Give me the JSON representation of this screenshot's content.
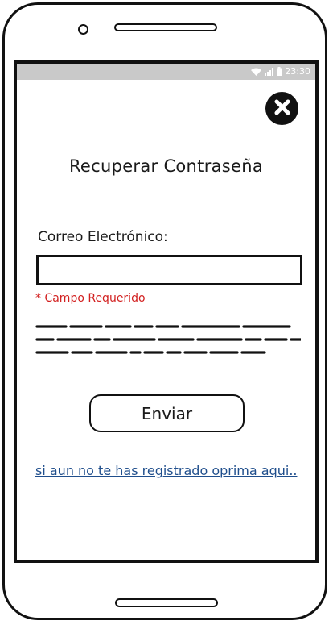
{
  "status_bar": {
    "time": "23:30"
  },
  "page": {
    "title": "Recuperar Contraseña",
    "email_label": "Correo Electrónico:",
    "email_value": "",
    "required_message": "* Campo Requerido",
    "submit_label": "Enviar",
    "register_link": "si aun no te has registrado oprima aqui.."
  },
  "colors": {
    "status_bar": "#c9c9c9",
    "error": "#d21f1f",
    "link": "#1f4e8c",
    "frame": "#111111"
  },
  "icons": {
    "close": "close-icon",
    "wifi": "wifi-icon",
    "signal": "signal-icon",
    "battery": "battery-icon"
  }
}
